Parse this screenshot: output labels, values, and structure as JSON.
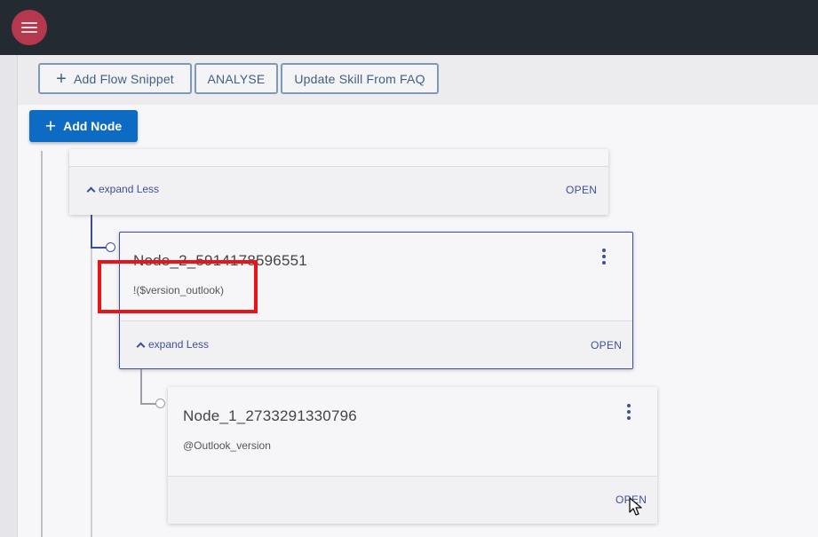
{
  "toolbar": {
    "add_flow_snippet": "Add Flow Snippet",
    "analyse": "ANALYSE",
    "update_skill": "Update Skill From FAQ"
  },
  "add_node": {
    "label": "Add Node"
  },
  "nodes": [
    {
      "expand_label": "expand Less",
      "open_label": "OPEN"
    },
    {
      "title": "Node_2_5914178596551",
      "condition": "!($version_outlook)",
      "expand_label": "expand Less",
      "open_label": "OPEN"
    },
    {
      "title": "Node_1_2733291330796",
      "condition": "@Outlook_version",
      "open_label": "OPEN"
    }
  ],
  "colors": {
    "topbar": "#232a31",
    "menu_button": "#b5384f",
    "primary": "#0d6bc4",
    "link": "#3d4f9a",
    "highlight": "#e8141a"
  }
}
